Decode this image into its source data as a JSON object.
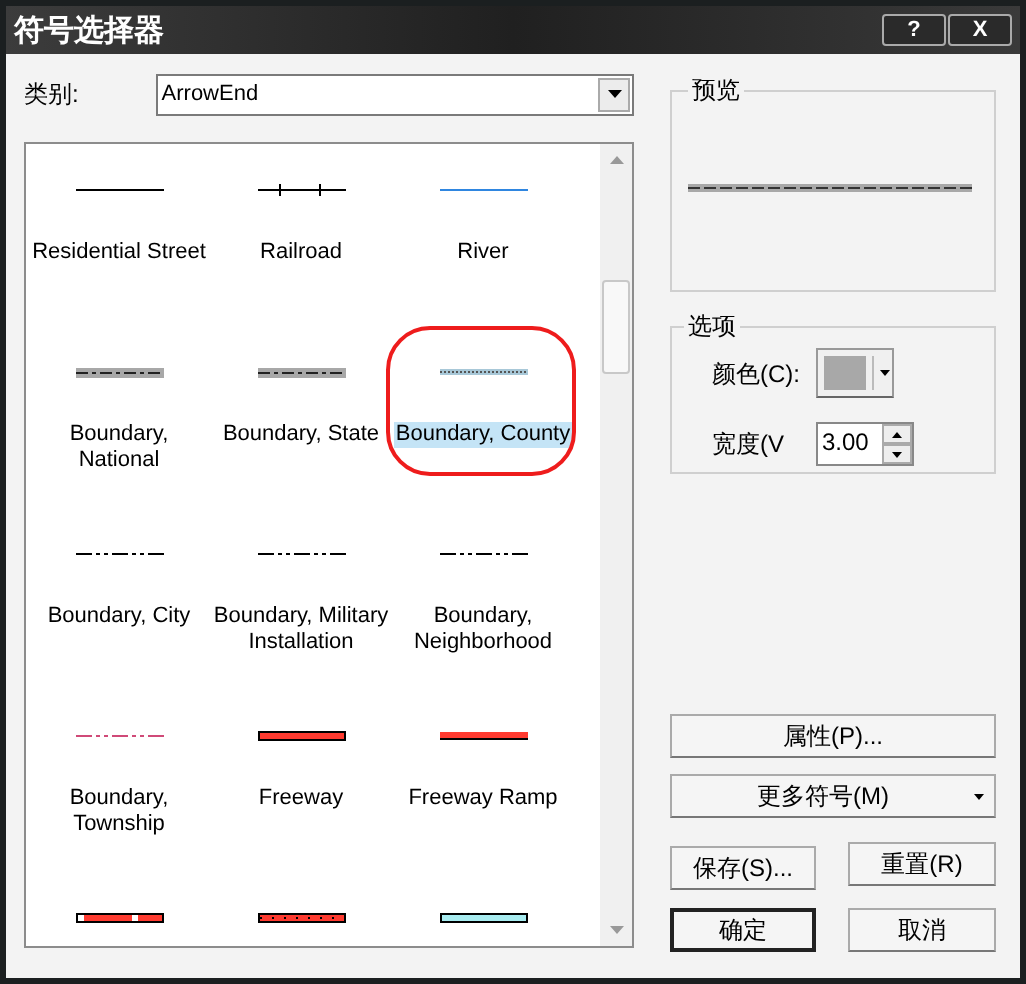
{
  "window": {
    "title": "符号选择器",
    "buttons": [
      "?",
      "X"
    ]
  },
  "category": {
    "label": "类别:",
    "value": "ArrowEnd"
  },
  "symbols": [
    {
      "label": "Residential Street",
      "kind": "solid",
      "color": "#000000",
      "selected": false,
      "circled": false
    },
    {
      "label": "Railroad",
      "kind": "ticks",
      "color": "#000000",
      "selected": false,
      "circled": false
    },
    {
      "label": "River",
      "kind": "solid",
      "color": "#2f86e0",
      "selected": false,
      "circled": false
    },
    {
      "label": "Boundary, National",
      "kind": "band",
      "color": "#a8a8a8",
      "selected": false,
      "circled": false
    },
    {
      "label": "Boundary, State",
      "kind": "band",
      "color": "#a8a8a8",
      "selected": false,
      "circled": false
    },
    {
      "label": "Boundary, County",
      "kind": "dotband",
      "color": "#a8c8d8",
      "selected": true,
      "circled": true
    },
    {
      "label": "Boundary, City",
      "kind": "dashdot",
      "color": "#000000",
      "selected": false,
      "circled": false
    },
    {
      "label": "Boundary, Military Installation",
      "kind": "dashdot",
      "color": "#000000",
      "selected": false,
      "circled": false
    },
    {
      "label": "Boundary, Neighborhood",
      "kind": "dashdot",
      "color": "#000000",
      "selected": false,
      "circled": false
    },
    {
      "label": "Boundary, Township",
      "kind": "dashdot",
      "color": "#d04a78",
      "selected": false,
      "circled": false
    },
    {
      "label": "Freeway",
      "kind": "cased",
      "color": "#ff3b30",
      "selected": false,
      "circled": false
    },
    {
      "label": "Freeway Ramp",
      "kind": "underlined",
      "color": "#ff3b30",
      "selected": false,
      "circled": false
    },
    {
      "kind": "cased-gap",
      "color": "#ff3b30",
      "selected": false,
      "circled": false
    },
    {
      "kind": "cased-dash",
      "color": "#ff3b30",
      "selected": false,
      "circled": false
    },
    {
      "kind": "cased",
      "color": "#a8ecf0",
      "selected": false,
      "circled": false
    }
  ],
  "preview": {
    "title": "预览"
  },
  "options": {
    "title": "选项",
    "color_label": "颜色(C):",
    "color": "#a8a8a8",
    "width_label": "宽度(V",
    "width_value": "3.00"
  },
  "buttons": {
    "properties": "属性(P)...",
    "more_symbols": "更多符号(M)",
    "save": "保存(S)...",
    "reset": "重置(R)",
    "ok": "确定",
    "cancel": "取消"
  }
}
